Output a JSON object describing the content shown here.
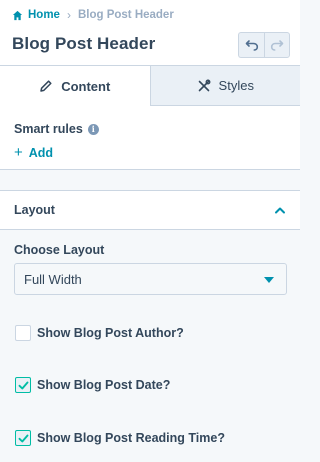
{
  "breadcrumb": {
    "home": "Home",
    "separator": "›",
    "current": "Blog Post Header"
  },
  "title": "Blog Post Header",
  "tabs": [
    {
      "label": "Content",
      "icon": "pencil-icon",
      "active": true
    },
    {
      "label": "Styles",
      "icon": "tools-icon",
      "active": false
    }
  ],
  "smart_rules": {
    "label": "Smart rules",
    "info": "i",
    "add_label": "Add"
  },
  "layout_section": {
    "label": "Layout",
    "expanded": true
  },
  "choose_layout": {
    "label": "Choose Layout",
    "selected": "Full Width"
  },
  "checkboxes": [
    {
      "label": "Show Blog Post Author?",
      "checked": false
    },
    {
      "label": "Show Blog Post Date?",
      "checked": true
    },
    {
      "label": "Show Blog Post Reading Time?",
      "checked": true
    }
  ],
  "colors": {
    "accent": "#0091ae",
    "check": "#00bda5",
    "text": "#33475b",
    "muted": "#99acc2"
  }
}
